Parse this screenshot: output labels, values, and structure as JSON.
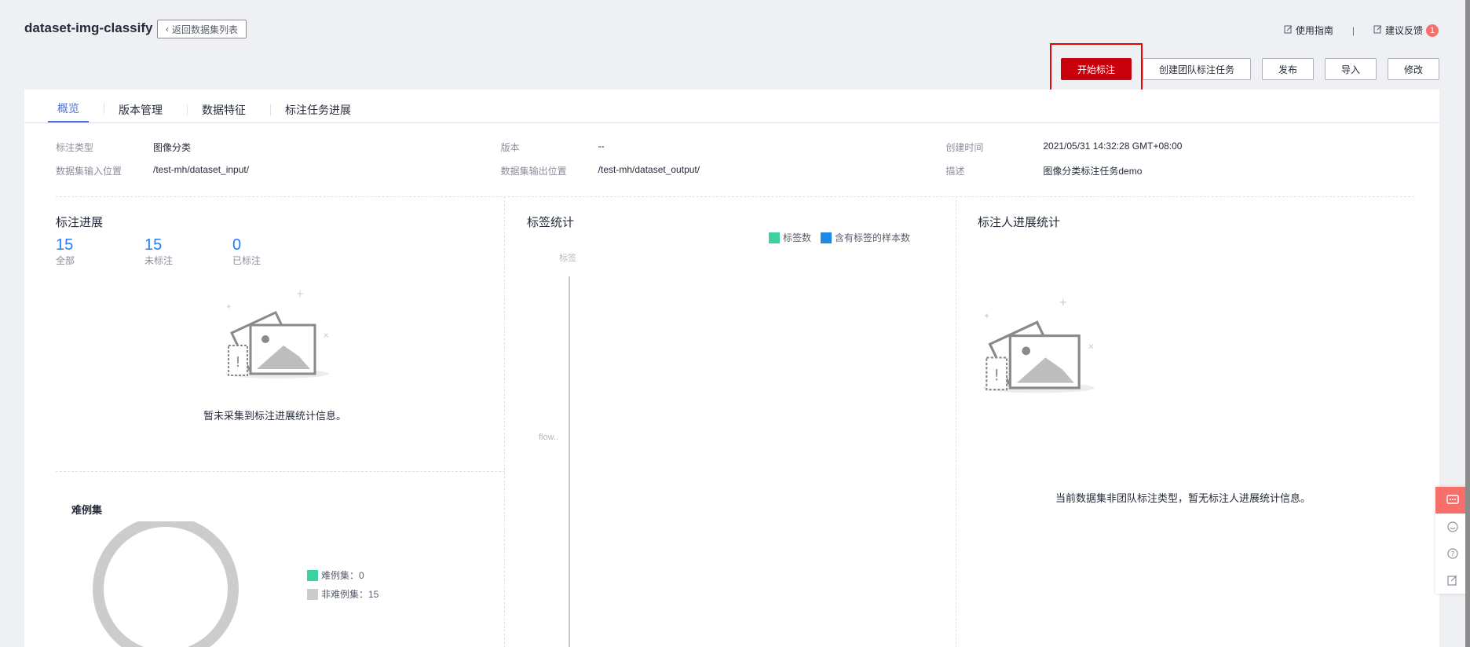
{
  "header": {
    "title": "dataset-img-classify",
    "back_label": "返回数据集列表",
    "guide_label": "使用指南",
    "separator": "|",
    "feedback_label": "建议反馈",
    "feedback_count": "1"
  },
  "actions": {
    "start_label": "开始标注",
    "team_label": "创建团队标注任务",
    "publish_label": "发布",
    "import_label": "导入",
    "edit_label": "修改"
  },
  "tabs": [
    {
      "label": "概览"
    },
    {
      "label": "版本管理"
    },
    {
      "label": "数据特征"
    },
    {
      "label": "标注任务进展"
    }
  ],
  "info": {
    "type_label": "标注类型",
    "type_value": "图像分类",
    "version_label": "版本",
    "version_value": "--",
    "created_label": "创建时间",
    "created_value": "2021/05/31 14:32:28 GMT+08:00",
    "input_label": "数据集输入位置",
    "input_value": "/test-mh/dataset_input/",
    "output_label": "数据集输出位置",
    "output_value": "/test-mh/dataset_output/",
    "desc_label": "描述",
    "desc_value": "图像分类标注任务demo"
  },
  "progress": {
    "title": "标注进展",
    "all_num": "15",
    "all_label": "全部",
    "un_num": "15",
    "un_label": "未标注",
    "done_num": "0",
    "done_label": "已标注",
    "empty_text": "暂未采集到标注进展统计信息。"
  },
  "label_stats": {
    "title": "标签统计",
    "legend_a": "标签数",
    "legend_b": "含有标签的样本数",
    "y_axis_label": "标签",
    "y_tick": "flow..",
    "colors": {
      "a": "#3ecfa3",
      "b": "#1e88e5"
    }
  },
  "labeler": {
    "title": "标注人进展统计",
    "empty_text": "当前数据集非团队标注类型，暂无标注人进展统计信息。"
  },
  "hard": {
    "title": "难例集",
    "legend_hard": "难例集：0",
    "legend_nonhard": "非难例集：15",
    "colors": {
      "hard": "#3ecfa3",
      "nonhard": "#cccccc"
    }
  },
  "chart_data": [
    {
      "type": "pie",
      "title": "难例集",
      "categories": [
        "难例集",
        "非难例集"
      ],
      "values": [
        0,
        15
      ]
    },
    {
      "type": "bar",
      "title": "标签统计",
      "categories": [
        "flow.."
      ],
      "series": [
        {
          "name": "标签数",
          "values": []
        },
        {
          "name": "含有标签的样本数",
          "values": []
        }
      ]
    }
  ]
}
